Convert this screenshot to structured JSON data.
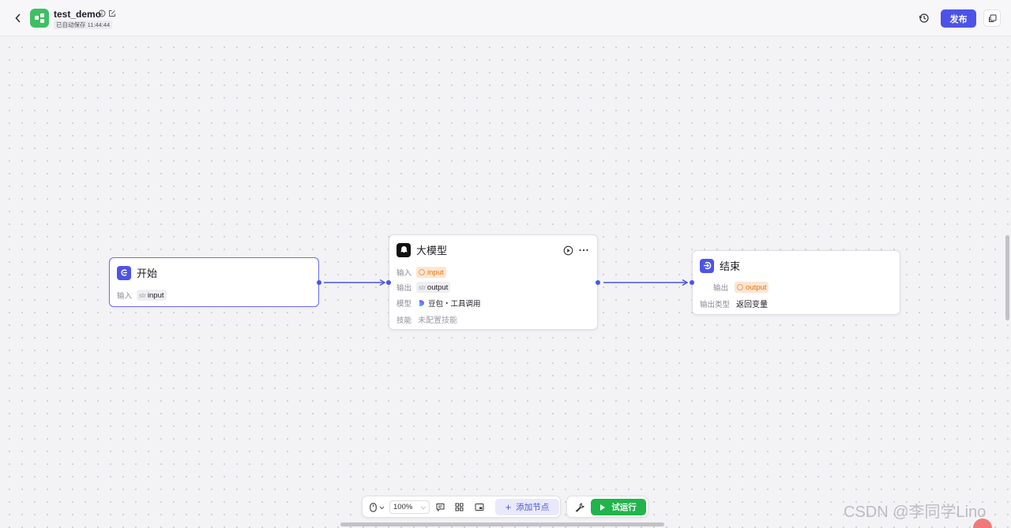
{
  "header": {
    "title": "test_demo",
    "autosave": "已自动保存 11:44:44",
    "publish_label": "发布"
  },
  "nodes": {
    "start": {
      "title": "开始",
      "input_label": "输入",
      "input_type": "str",
      "input_name": "input"
    },
    "llm": {
      "title": "大模型",
      "input_label": "输入",
      "input_name": "input",
      "output_label": "输出",
      "output_type": "str",
      "output_name": "output",
      "model_label": "模型",
      "model_value": "豆包・工具调用",
      "skill_label": "技能",
      "skill_value": "未配置技能"
    },
    "end": {
      "title": "结束",
      "output_label": "输出",
      "output_name": "output",
      "output_type_label": "输出类型",
      "output_type_value": "返回变量"
    }
  },
  "toolbar": {
    "zoom": "100%",
    "add_node_label": "添加节点",
    "run_label": "试运行"
  },
  "watermark": "CSDN @李同学Lino",
  "colors": {
    "accent": "#4d53e8",
    "run": "#1fb54a",
    "logo": "#3fbf64",
    "variable_ref": "#e8750d"
  }
}
